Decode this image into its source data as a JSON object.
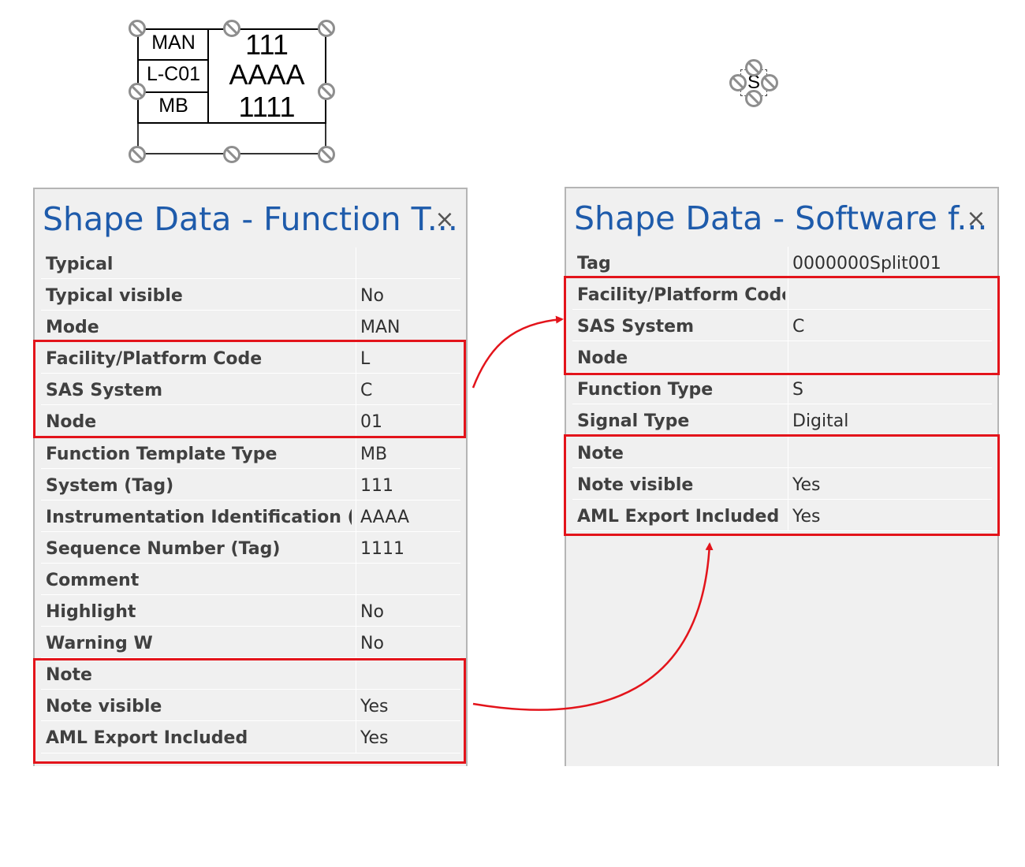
{
  "shape_function": {
    "labels": [
      "MAN",
      "L-C01",
      "MB"
    ],
    "values": [
      "111",
      "AAAA",
      "1111"
    ]
  },
  "shape_software": {
    "letter": "S"
  },
  "left_panel": {
    "title": "Shape Data - Function T...",
    "close": "×",
    "rows": [
      {
        "key": "Typical",
        "value": ""
      },
      {
        "key": "Typical visible",
        "value": "No"
      },
      {
        "key": "Mode",
        "value": "MAN"
      },
      {
        "key": "Facility/Platform Code",
        "value": "L"
      },
      {
        "key": "SAS System",
        "value": "C"
      },
      {
        "key": "Node",
        "value": "01"
      },
      {
        "key": "Function Template Type",
        "value": "MB"
      },
      {
        "key": "System (Tag)",
        "value": "111"
      },
      {
        "key": "Instrumentation Identification (Ta",
        "value": "AAAA"
      },
      {
        "key": "Sequence Number (Tag)",
        "value": "1111"
      },
      {
        "key": "Comment",
        "value": ""
      },
      {
        "key": "Highlight",
        "value": "No"
      },
      {
        "key": "Warning W",
        "value": "No"
      },
      {
        "key": "Note",
        "value": ""
      },
      {
        "key": "Note visible",
        "value": "Yes"
      },
      {
        "key": "AML Export Included",
        "value": "Yes"
      }
    ]
  },
  "right_panel": {
    "title": "Shape Data - Software f...",
    "close": "×",
    "rows": [
      {
        "key": "Tag",
        "value": "0000000Split001"
      },
      {
        "key": "Facility/Platform Code",
        "value": ""
      },
      {
        "key": "SAS System",
        "value": "C"
      },
      {
        "key": "Node",
        "value": ""
      },
      {
        "key": "Function Type",
        "value": "S"
      },
      {
        "key": "Signal Type",
        "value": "Digital"
      },
      {
        "key": "Note",
        "value": ""
      },
      {
        "key": "Note visible",
        "value": "Yes"
      },
      {
        "key": "AML Export Included",
        "value": "Yes"
      }
    ]
  },
  "colors": {
    "highlight": "#e3141b",
    "title": "#1e5bab",
    "panel_bg": "#f0f0f0"
  }
}
